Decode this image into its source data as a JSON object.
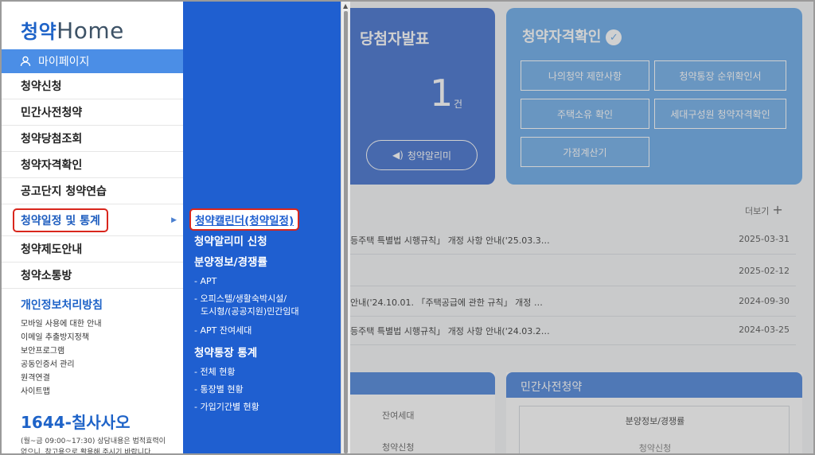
{
  "logo": {
    "prefix": "청약",
    "suffix": "Home"
  },
  "sidebar": {
    "mypage": "마이페이지",
    "items": [
      {
        "label": "청약신청"
      },
      {
        "label": "민간사전청약"
      },
      {
        "label": "청약당첨조회"
      },
      {
        "label": "청약자격확인"
      },
      {
        "label": "공고단지 청약연습"
      },
      {
        "label": "청약일정 및 통계"
      },
      {
        "label": "청약제도안내"
      },
      {
        "label": "청약소통방"
      }
    ],
    "policy_title": "개인정보처리방침",
    "links": [
      "모바일 사용에 대한 안내",
      "이메일 추출방지정책",
      "보안프로그램",
      "공동인증서 관리",
      "원격연결",
      "사이트맵"
    ],
    "phone": "1644-칠사사오",
    "notice_1": "(월~금 09:00~17:30) 상담내용은 법적효력이",
    "notice_2": "없으니, 참고용으로 활용해 주시기 바랍니다."
  },
  "submenu": {
    "calendar": "청약캘린더(청약일정)",
    "alarm_apply": "청약알리미 신청",
    "supply_info": "분양정보/경쟁률",
    "apt": "- APT",
    "officetel_1": "- 오피스텔/생활숙박시설/",
    "officetel_2": "도시형/(공공지원)민간임대",
    "apt_remain": "- APT 잔여세대",
    "account_stats": "청약통장 통계",
    "total": "- 전체 현황",
    "by_account": "- 통장별 현황",
    "by_period": "- 가입기간별 현황"
  },
  "main": {
    "winner_title": "당첨자발표",
    "winner_count": "1",
    "winner_unit": "건",
    "alarm_button": "청약알리미",
    "qual_title": "청약자격확인",
    "qual_buttons": [
      "나의청약 제한사항",
      "청약통장 순위확인서",
      "주택소유 확인",
      "세대구성원 청약자격확인",
      "가점계산기"
    ],
    "more": "더보기",
    "news": [
      {
        "title": "등주택 특별법 시행규칙」 개정 사항 안내('25.03.3…",
        "date": "2025-03-31"
      },
      {
        "title": "",
        "date": "2025-02-12"
      },
      {
        "title": "안내('24.10.01. 「주택공급에 관한 규칙」 개정 …",
        "date": "2024-09-30"
      },
      {
        "title": "등주택 특별법 시행규칙」 개정 사항 안내('24.03.2…",
        "date": "2024-03-25"
      }
    ],
    "left_panel_row1": "잔여세대",
    "left_panel_row2": "청약신청",
    "right_panel_title": "민간사전청약",
    "right_panel_row1": "분양정보/경쟁률",
    "right_panel_row2": "청약신청"
  }
}
